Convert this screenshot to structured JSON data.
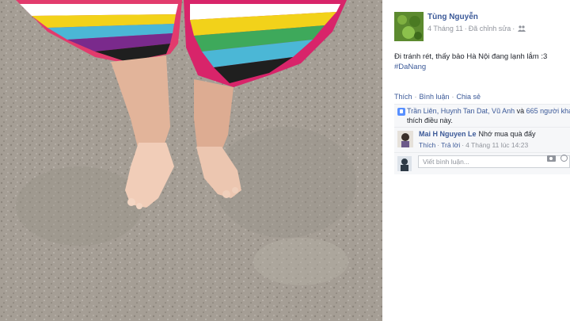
{
  "post": {
    "author": "Tùng Nguyễn",
    "date": "4 Tháng 11",
    "edited": "Đã chỉnh sửa",
    "text": "Đi tránh rét, thấy bảo Hà Nội đang lạnh lắm :3",
    "hashtag": "#DaNang"
  },
  "actions": {
    "like": "Thích",
    "comment": "Bình luận",
    "share": "Chia sẻ"
  },
  "likes": {
    "names": "Trần Liên, Huynh Tan Dat, Vũ Anh",
    "and": " và ",
    "others": "665 người khác",
    "suffix": "thích điều này."
  },
  "comment": {
    "author": "Mai H Nguyen Le",
    "text": "Nhớ mua quà đấy",
    "like": "Thích",
    "reply": "Trả lời",
    "time": "4 Tháng 11 lúc 14:23"
  },
  "write_comment": {
    "placeholder": "Viết bình luận..."
  },
  "icons": {
    "like": "thumbs-up-icon",
    "audience": "friends-icon",
    "camera": "camera-icon",
    "emoji": "emoji-icon"
  },
  "colors": {
    "link": "#3b5998",
    "text": "#1d2129",
    "muted": "#90949c",
    "panel_bg": "#ffffff",
    "section_bg": "#f6f7f9"
  }
}
